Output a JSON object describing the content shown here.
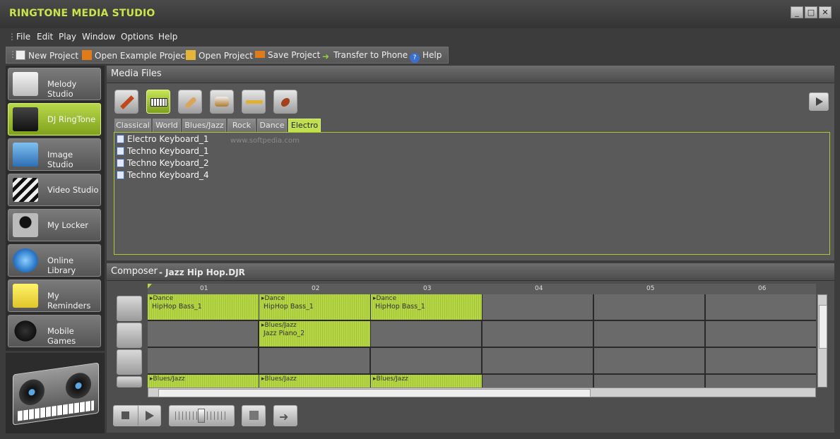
{
  "window": {
    "title": "RINGTONE MEDIA STUDIO",
    "minimize": "_",
    "maximize": "□",
    "close": "✕"
  },
  "menu": {
    "items": [
      "File",
      "Edit",
      "Play",
      "Window",
      "Options",
      "Help"
    ]
  },
  "toolbar": {
    "new_project": "New Project",
    "open_example": "Open Example Project",
    "open_project": "Open Project",
    "save_project": "Save Project",
    "transfer": "Transfer to Phone",
    "help": "Help"
  },
  "sidebar": {
    "items": [
      {
        "label": "Melody Studio",
        "icon": "music-score-icon"
      },
      {
        "label": "DJ RingTone",
        "icon": "dj-mixer-icon",
        "active": true
      },
      {
        "label": "Image Studio",
        "icon": "image-icon"
      },
      {
        "label": "Video Studio",
        "icon": "clapperboard-icon"
      },
      {
        "label": "My Locker",
        "icon": "user-silhouette-icon"
      },
      {
        "label": "Online Library",
        "icon": "globe-icon"
      },
      {
        "label": "My Reminders",
        "icon": "sticky-note-icon"
      },
      {
        "label": "Mobile Games",
        "icon": "gamepad-icon"
      }
    ]
  },
  "media": {
    "title": "Media Files",
    "instruments": [
      "electric-guitar-icon",
      "keyboard-icon",
      "acoustic-guitar-icon",
      "drum-icon",
      "trumpet-icon",
      "violin-icon"
    ],
    "tabs": [
      "Classical",
      "World",
      "Blues/Jazz",
      "Rock",
      "Dance",
      "Electro"
    ],
    "active_tab": "Electro",
    "files": [
      "Electro Keyboard_1",
      "Techno Keyboard_1",
      "Techno Keyboard_2",
      "Techno Keyboard_4"
    ],
    "watermark": "www.softpedia.com"
  },
  "composer": {
    "title": "Composer",
    "project": "- Jazz Hip Hop.DJR",
    "ruler": [
      "01",
      "02",
      "03",
      "04",
      "05",
      "06"
    ],
    "clips": [
      {
        "track": 0,
        "beat": 0,
        "genre": "Dance",
        "name": "HipHop Bass_1"
      },
      {
        "track": 0,
        "beat": 1,
        "genre": "Dance",
        "name": "HipHop Bass_1"
      },
      {
        "track": 0,
        "beat": 2,
        "genre": "Dance",
        "name": "HipHop Bass_1"
      },
      {
        "track": 1,
        "beat": 1,
        "genre": "Blues/Jazz",
        "name": "Jazz Piano_2"
      },
      {
        "track": 3,
        "beat": 0,
        "genre": "Blues/Jazz",
        "name": ""
      },
      {
        "track": 3,
        "beat": 1,
        "genre": "Blues/Jazz",
        "name": ""
      },
      {
        "track": 3,
        "beat": 2,
        "genre": "Blues/Jazz",
        "name": ""
      }
    ]
  },
  "colors": {
    "accent": "#b5d645",
    "background": "#3c3c3c"
  }
}
